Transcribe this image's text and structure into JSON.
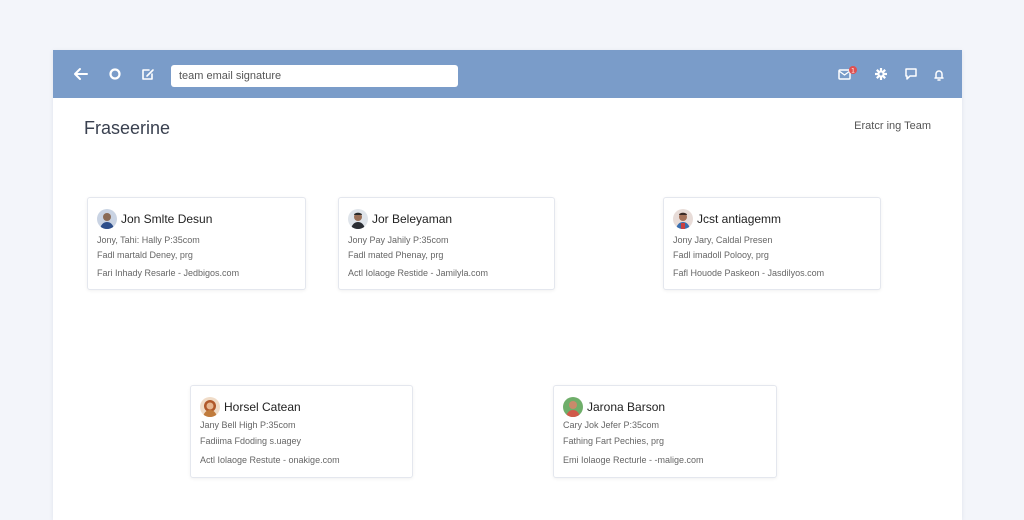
{
  "toolbar": {
    "search_value": "team email signature",
    "notification_count": "1"
  },
  "page": {
    "title": "Fraseerine",
    "team_link": "Eratcr ing  Team"
  },
  "cards": [
    {
      "name": "Jon Smlte Desun",
      "line1": "Jony, Tahi: Hally P:35com",
      "line2": "Fadl martald Deney, prg",
      "line3": "Fari Inhady Resarle - Jedbigos.com"
    },
    {
      "name": "Jor Beleyaman",
      "line1": "Jony Pay Jahily P:35com",
      "line2": "Fadl mated Phenay, prg",
      "line3": "Actl Iolaoge Restide - Jamilyla.com"
    },
    {
      "name": "Jcst antiagemm",
      "line1": "Jony Jary, Caldal Presen",
      "line2": "Fadl imadoll Polooy, prg",
      "line3": "Fafl Houode Paskeon - Jasdilyos.com"
    },
    {
      "name": "Horsel Catean",
      "line1": "Jany Bell High P:35com",
      "line2": "Fadiima Fdoding s.uagey",
      "line3": "Actl Iolaoge Restute - onakige.com"
    },
    {
      "name": "Jarona Barson",
      "line1": "Cary Jok Jefer P:35com",
      "line2": "Fathing Fart Pechies, prg",
      "line3": "Emi Iolaoge Recturle - -malige.com"
    }
  ]
}
